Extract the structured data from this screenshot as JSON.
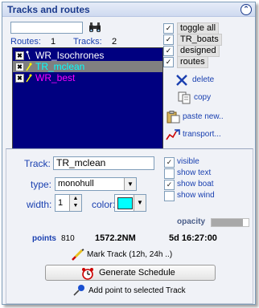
{
  "panel": {
    "title": "Tracks and routes"
  },
  "upper": {
    "search_value": "",
    "routes_label": "Routes:",
    "routes_count": "1",
    "tracks_label": "Tracks:",
    "tracks_count": "2",
    "list_items": [
      {
        "label": "WR_Isochrones",
        "color": "#ffffff",
        "checked": true,
        "selected": false
      },
      {
        "label": "TR_mclean",
        "color": "#00ffff",
        "checked": true,
        "selected": true
      },
      {
        "label": "WR_best",
        "color": "#ff00ff",
        "checked": true,
        "selected": false
      }
    ],
    "toggles": [
      {
        "label": "toggle all",
        "checked": true
      },
      {
        "label": "TR_boats",
        "checked": true
      },
      {
        "label": "designed",
        "checked": true
      },
      {
        "label": "routes",
        "checked": true
      }
    ],
    "actions": {
      "delete": "delete",
      "copy": "copy",
      "paste_new": "paste new..",
      "transport": "transport..."
    }
  },
  "lower": {
    "track_label": "Track:",
    "track_value": "TR_mclean",
    "type_label": "type:",
    "type_value": "monohull",
    "width_label": "width:",
    "width_value": "1",
    "color_label": "color:",
    "color_value": "#00ffff",
    "checks": [
      {
        "label": "visible",
        "checked": true
      },
      {
        "label": "show text",
        "checked": false
      },
      {
        "label": "show boat",
        "checked": true
      },
      {
        "label": "show wind",
        "checked": false
      }
    ],
    "opacity_label": "opacity",
    "opacity_fraction": 0.85,
    "points_label": "points",
    "points_value": "810",
    "distance": "1572.2NM",
    "duration": "5d 16:27:00",
    "mark_track": "Mark Track (12h, 24h ..)",
    "generate_schedule": "Generate Schedule",
    "add_point": "Add point to selected Track"
  },
  "colors": {
    "title": "#1b3a8c",
    "label_blue": "#1a40b0",
    "list_bg": "#000080"
  }
}
